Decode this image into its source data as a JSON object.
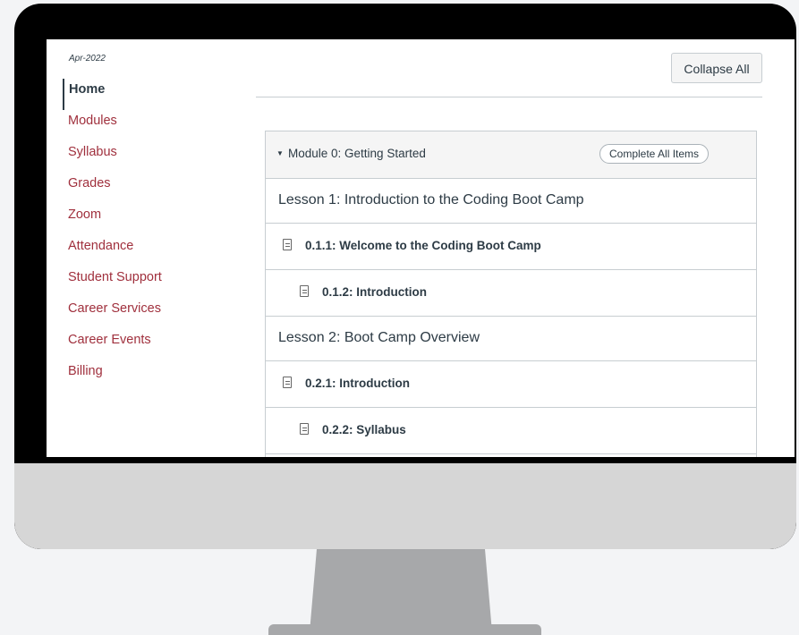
{
  "sidebar": {
    "date": "Apr-2022",
    "items": [
      {
        "label": "Home"
      },
      {
        "label": "Modules"
      },
      {
        "label": "Syllabus"
      },
      {
        "label": "Grades"
      },
      {
        "label": "Zoom"
      },
      {
        "label": "Attendance"
      },
      {
        "label": "Student Support"
      },
      {
        "label": "Career Services"
      },
      {
        "label": "Career Events"
      },
      {
        "label": "Billing"
      }
    ],
    "active_index": 0
  },
  "toolbar": {
    "collapse_label": "Collapse All"
  },
  "module": {
    "title": "Module 0: Getting Started",
    "complete_label": "Complete All Items",
    "rows": [
      {
        "type": "lesson",
        "label": "Lesson 1: Introduction to the Coding Boot Camp"
      },
      {
        "type": "item",
        "level": 1,
        "label": "0.1.1: Welcome to the Coding Boot Camp",
        "icon": "document-icon"
      },
      {
        "type": "item",
        "level": 2,
        "label": "0.1.2: Introduction",
        "icon": "document-icon"
      },
      {
        "type": "lesson",
        "label": "Lesson 2: Boot Camp Overview"
      },
      {
        "type": "item",
        "level": 1,
        "label": "0.2.1: Introduction",
        "icon": "document-icon"
      },
      {
        "type": "item",
        "level": 2,
        "label": "0.2.2: Syllabus",
        "icon": "document-icon"
      }
    ]
  },
  "colors": {
    "link": "#a0303d",
    "text": "#2d3b45",
    "border": "#c7cdd1",
    "header_bg": "#f5f5f5"
  }
}
